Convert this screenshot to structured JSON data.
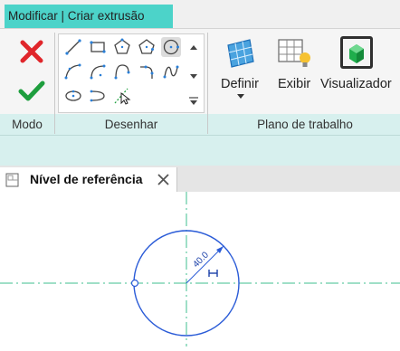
{
  "ribbon": {
    "active_tab": "Modificar | Criar extrusão",
    "groups": {
      "mode": "Modo",
      "draw": "Desenhar",
      "workplane": "Plano de trabalho"
    },
    "buttons": {
      "define": "Definir",
      "show": "Exibir",
      "viewer": "Visualizador"
    }
  },
  "view": {
    "tab_title": "Nível de referência",
    "dimension_value": "40.0"
  },
  "colors": {
    "ribbon_accent": "#4cd3c9",
    "group_band": "#d7f0ee",
    "sketch_line": "#2a5bd7",
    "reference_plane": "#3fbf8f",
    "cancel": "#e0262b",
    "finish": "#1e9e3e"
  },
  "icons": [
    "cancel-icon",
    "finish-icon",
    "line-tool-icon",
    "rectangle-tool-icon",
    "inscribed-polygon-icon",
    "circumscribed-polygon-icon",
    "circle-tool-icon",
    "start-end-arc-icon",
    "center-arc-icon",
    "tangent-arc-icon",
    "fillet-arc-icon",
    "spline-icon",
    "ellipse-icon",
    "partial-ellipse-icon",
    "pick-lines-icon",
    "define-workplane-icon",
    "show-workplane-icon",
    "viewer-icon",
    "view-close-icon",
    "floor-plan-icon"
  ]
}
